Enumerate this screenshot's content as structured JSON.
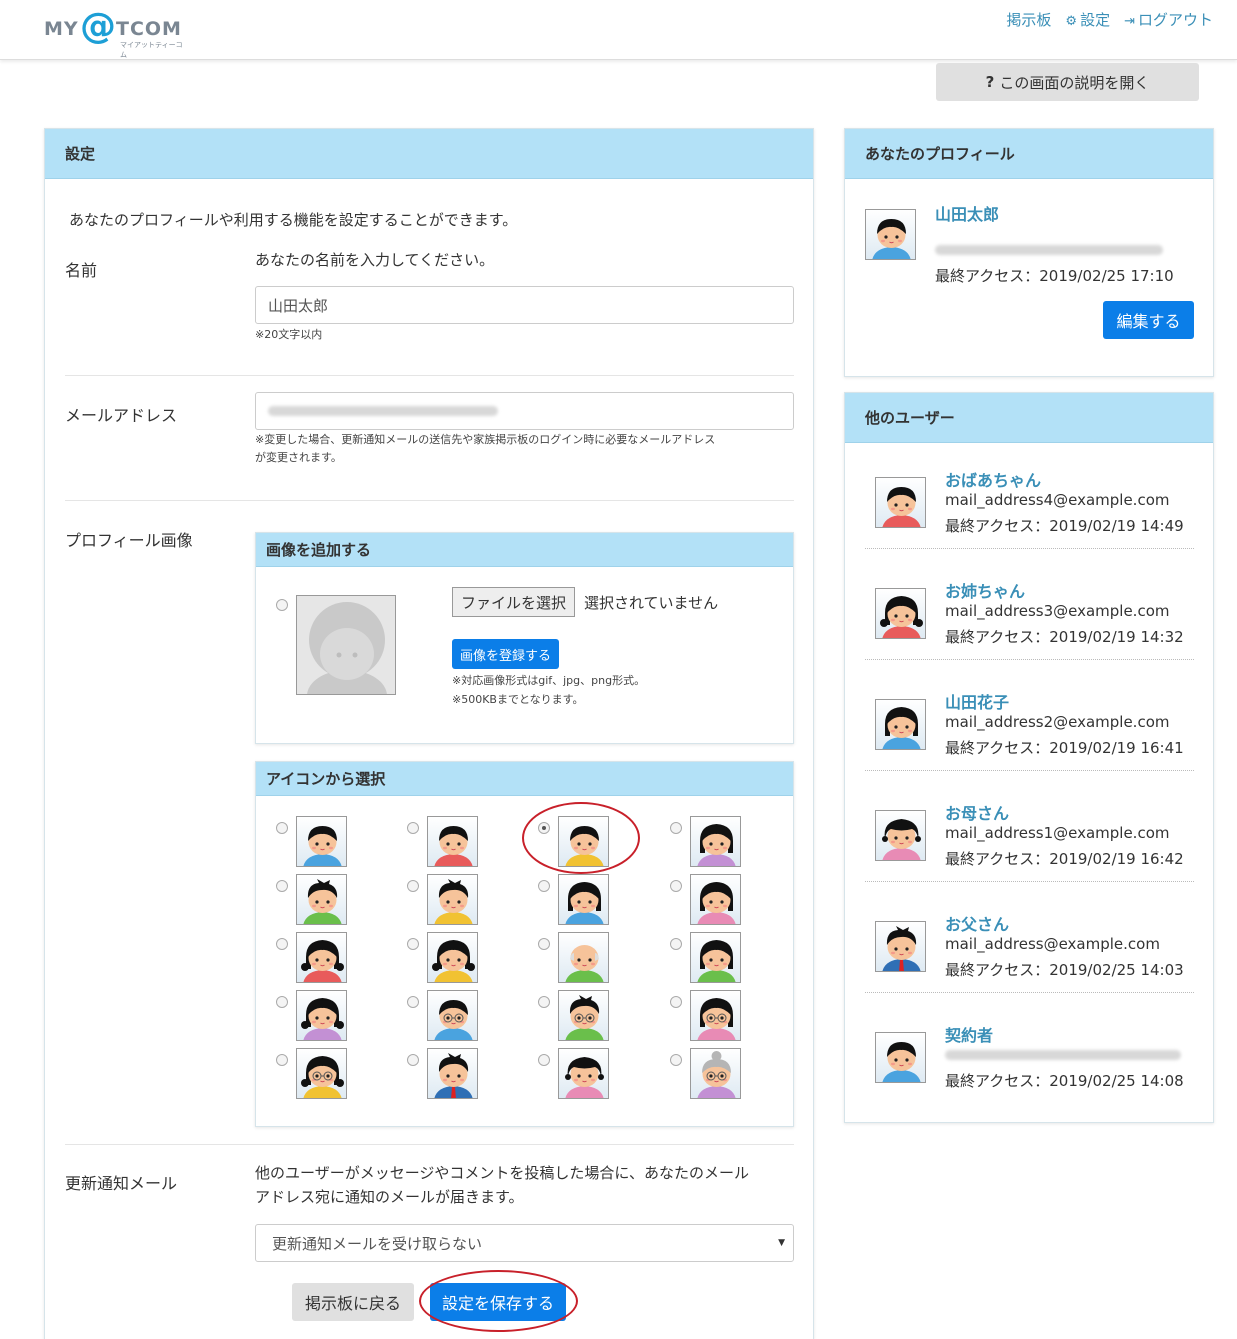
{
  "header": {
    "logo_my": "MY",
    "logo_at": "@",
    "logo_tcom": "TCOM",
    "logo_sub": "マイアットティーコム",
    "nav": [
      "掲示板",
      "設定",
      "ログアウト"
    ]
  },
  "help_button": "この画面の説明を開く",
  "settings": {
    "title": "設定",
    "intro": "あなたのプロフィールや利用する機能を設定することができます。",
    "name_label": "名前",
    "name_hint": "あなたの名前を入力してください。",
    "name_value": "山田太郎",
    "name_note": "※20文字以内",
    "email_label": "メールアドレス",
    "email_note_1": "※変更した場合、更新通知メールの送信先や家族掲示板のログイン時に必要なメールアドレス",
    "email_note_2": "が変更されます。",
    "image_label": "プロフィール画像",
    "add_image_title": "画像を追加する",
    "file_button": "ファイルを選択",
    "file_status": "選択されていません",
    "register_button": "画像を登録する",
    "format_note_1": "※対応画像形式はgif、jpg、png形式。",
    "format_note_2": "※500KBまでとなります。",
    "icon_select_title": "アイコンから選択",
    "selected_icon_index": 2,
    "notify_label": "更新通知メール",
    "notify_desc_1": "他のユーザーがメッセージやコメントを投稿した場合に、あなたのメール",
    "notify_desc_2": "アドレス宛に通知のメールが届きます。",
    "notify_selected": "更新通知メールを受け取らない",
    "back_button": "掲示板に戻る",
    "save_button": "設定を保存する"
  },
  "profile": {
    "title": "あなたのプロフィール",
    "name": "山田太郎",
    "last_access": "最終アクセス：2019/02/25 17:10",
    "edit_button": "編集する"
  },
  "other_users": {
    "title": "他のユーザー",
    "users": [
      {
        "name": "おばあちゃん",
        "email": "mail_address4@example.com",
        "last_access": "最終アクセス：2019/02/19 14:49"
      },
      {
        "name": "お姉ちゃん",
        "email": "mail_address3@example.com",
        "last_access": "最終アクセス：2019/02/19 14:32"
      },
      {
        "name": "山田花子",
        "email": "mail_address2@example.com",
        "last_access": "最終アクセス：2019/02/19 16:41"
      },
      {
        "name": "お母さん",
        "email": "mail_address1@example.com",
        "last_access": "最終アクセス：2019/02/19 16:42"
      },
      {
        "name": "お父さん",
        "email": "mail_address@example.com",
        "last_access": "最終アクセス：2019/02/25 14:03"
      },
      {
        "name": "契約者",
        "email": "",
        "last_access": "最終アクセス：2019/02/25 14:08"
      }
    ]
  }
}
